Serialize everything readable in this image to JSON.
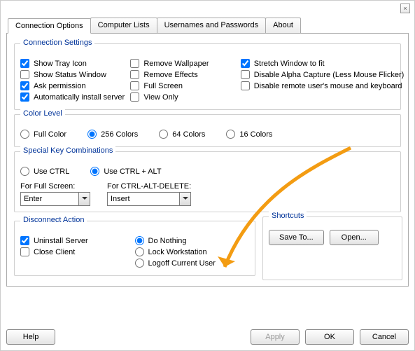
{
  "window": {
    "close": "×"
  },
  "tabs": {
    "t0": "Connection Options",
    "t1": "Computer Lists",
    "t2": "Usernames and Passwords",
    "t3": "About"
  },
  "conn_settings": {
    "title": "Connection Settings",
    "show_tray": "Show Tray Icon",
    "show_status": "Show Status Window",
    "ask_perm": "Ask permission",
    "auto_install": "Automatically install server",
    "remove_wallpaper": "Remove Wallpaper",
    "remove_effects": "Remove Effects",
    "full_screen": "Full Screen",
    "view_only": "View Only",
    "stretch": "Stretch Window to fit",
    "disable_alpha": "Disable Alpha Capture (Less Mouse Flicker)",
    "disable_remote": "Disable remote user's mouse and keyboard"
  },
  "color": {
    "title": "Color Level",
    "full": "Full Color",
    "c256": "256 Colors",
    "c64": "64 Colors",
    "c16": "16 Colors"
  },
  "keys": {
    "title": "Special Key Combinations",
    "ctrl": "Use CTRL",
    "ctrlalt": "Use CTRL + ALT",
    "for_fs": "For Full Screen:",
    "for_cad": "For CTRL-ALT-DELETE:",
    "fs_val": "Enter",
    "cad_val": "Insert"
  },
  "disc": {
    "title": "Disconnect Action",
    "uninstall": "Uninstall Server",
    "close_client": "Close Client",
    "do_nothing": "Do Nothing",
    "lock": "Lock Workstation",
    "logoff": "Logoff Current User"
  },
  "shortcuts": {
    "title": "Shortcuts",
    "save": "Save To...",
    "open": "Open..."
  },
  "footer": {
    "help": "Help",
    "apply": "Apply",
    "ok": "OK",
    "cancel": "Cancel"
  }
}
